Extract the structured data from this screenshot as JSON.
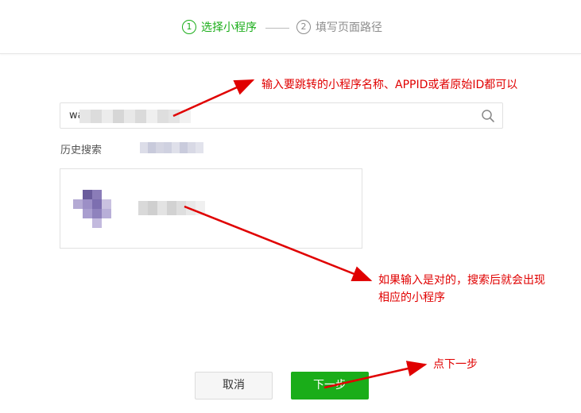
{
  "stepper": {
    "step1": {
      "number": "1",
      "label": "选择小程序"
    },
    "step2": {
      "number": "2",
      "label": "填写页面路径"
    }
  },
  "search": {
    "value_visible": "wa",
    "icon": "search-icon"
  },
  "history": {
    "label": "历史搜索"
  },
  "annotations": {
    "input_hint": "输入要跳转的小程序名称、APPID或者原始ID都可以",
    "result_hint_line1": "如果输入是对的，搜索后就会出现",
    "result_hint_line2": "相应的小程序",
    "next_hint": "点下一步"
  },
  "buttons": {
    "cancel": "取消",
    "next": "下一步"
  },
  "colors": {
    "accent": "#1aad19",
    "annotation": "#e00000",
    "inactive": "#8c8c8c"
  }
}
